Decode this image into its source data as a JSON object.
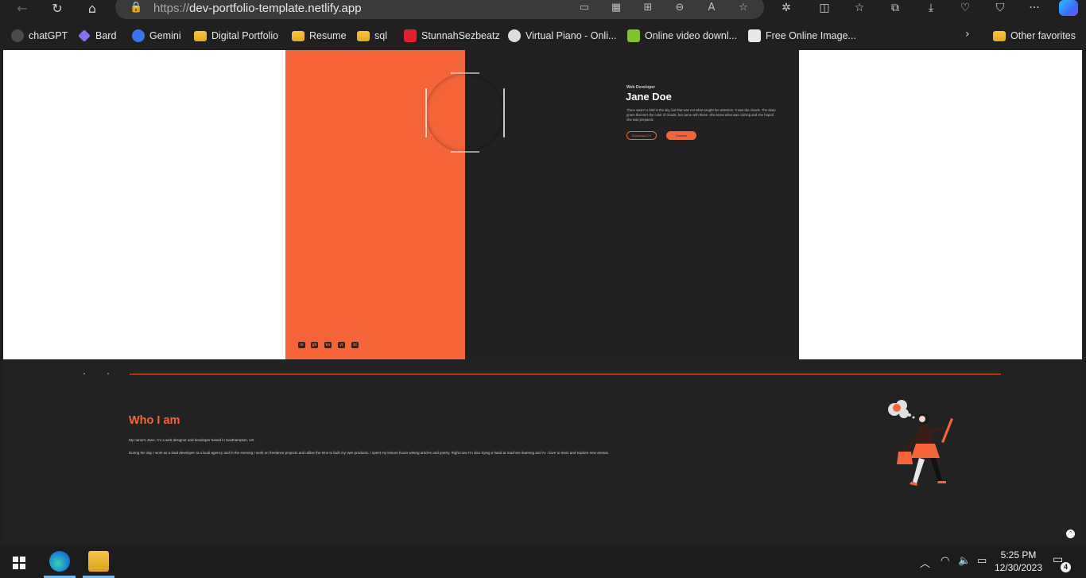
{
  "browser": {
    "url_scheme": "https://",
    "url_host": "dev-portfolio-template.netlify.app",
    "nav": {
      "back": "←",
      "refresh": "↻",
      "home": "⌂"
    },
    "address_icons": [
      "app-available-icon",
      "extensions-grid-icon",
      "split-icon",
      "zoom-out-icon",
      "read-aloud-icon",
      "favorite-star-icon"
    ],
    "toolbar_icons": [
      "extensions-icon",
      "split-screen-icon",
      "favorites-icon",
      "collections-icon",
      "downloads-icon",
      "browser-essentials-icon",
      "copilot-shield-icon",
      "more-icon"
    ],
    "more_label": "···"
  },
  "favorites": [
    {
      "label": "chatGPT",
      "icon": "chatgpt-icon",
      "color": "#4a4a4a"
    },
    {
      "label": "Bard",
      "icon": "bard-icon",
      "color": "#8a6ff0"
    },
    {
      "label": "Gemini",
      "icon": "gemini-icon",
      "color": "#3c74f0"
    },
    {
      "label": "Digital Portfolio",
      "icon": "folder-icon",
      "color": "#f0b72b"
    },
    {
      "label": "Resume",
      "icon": "folder-icon",
      "color": "#f0b72b"
    },
    {
      "label": "sql",
      "icon": "folder-icon",
      "color": "#f0b72b"
    },
    {
      "label": "StunnahSezbeatz",
      "icon": "stunnah-icon",
      "color": "#e0202a"
    },
    {
      "label": "Virtual Piano - Onli...",
      "icon": "piano-icon",
      "color": "#dddddd"
    },
    {
      "label": "Online video downl...",
      "icon": "download-arrow-icon",
      "color": "#7fc42a"
    },
    {
      "label": "Free Online Image...",
      "icon": "image-tool-icon",
      "color": "#e8e8e8"
    }
  ],
  "other_favorites": "Other favorites",
  "page": {
    "hero": {
      "subtitle": "Web Developer",
      "name": "Jane Doe",
      "bio": "There wasn't a bird in the sky, but that was not what caught her attention. It was the clouds. The deep green that isn't the color of clouds, but came with these. She knew what was coming and she hoped she was prepared.",
      "download_cv": "Download CV",
      "contact": "Contact"
    },
    "social": [
      "in",
      "gh",
      "tw",
      "yt",
      "bl"
    ],
    "about": {
      "title": "Who I am",
      "p1": "My name's Jane. I'm a web designer and developer based in Southampton, UK.",
      "p2": "During the day I work as a lead developer at a local agency and in the evening I work on freelance projects and utilise the time to built my own products. I spent my leisure hours writing articles and poetry. Right now I'm also trying a hand at machine learning and AI. I love to learn and explore new arenas."
    },
    "accent_color": "#f6653a",
    "scroll_top": "⌃"
  },
  "taskbar": {
    "time": "5:25 PM",
    "date": "12/30/2023",
    "notifications": "4",
    "tray_icons": [
      "chevron-up-icon",
      "wifi-icon",
      "volume-icon",
      "battery-icon"
    ]
  }
}
